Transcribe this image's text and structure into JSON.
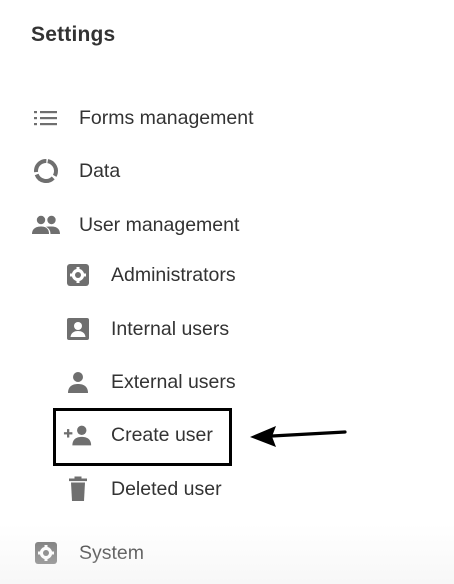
{
  "page": {
    "title": "Settings"
  },
  "menu": {
    "items": [
      {
        "label": "Forms management",
        "icon": "list-icon"
      },
      {
        "label": "Data",
        "icon": "donut-icon"
      },
      {
        "label": "User management",
        "icon": "people-icon"
      }
    ],
    "user_management_children": [
      {
        "label": "Administrators",
        "icon": "gear-icon"
      },
      {
        "label": "Internal users",
        "icon": "account-box-icon"
      },
      {
        "label": "External users",
        "icon": "person-icon"
      },
      {
        "label": "Create user",
        "icon": "person-add-icon"
      },
      {
        "label": "Deleted user",
        "icon": "trash-icon"
      }
    ],
    "system": {
      "label": "System",
      "icon": "gear-icon"
    }
  },
  "annotation": {
    "highlighted_item": "Create user",
    "arrow_direction": "left"
  },
  "colors": {
    "icon": "#6f6f6f",
    "text": "#333333",
    "annotation": "#000000"
  }
}
